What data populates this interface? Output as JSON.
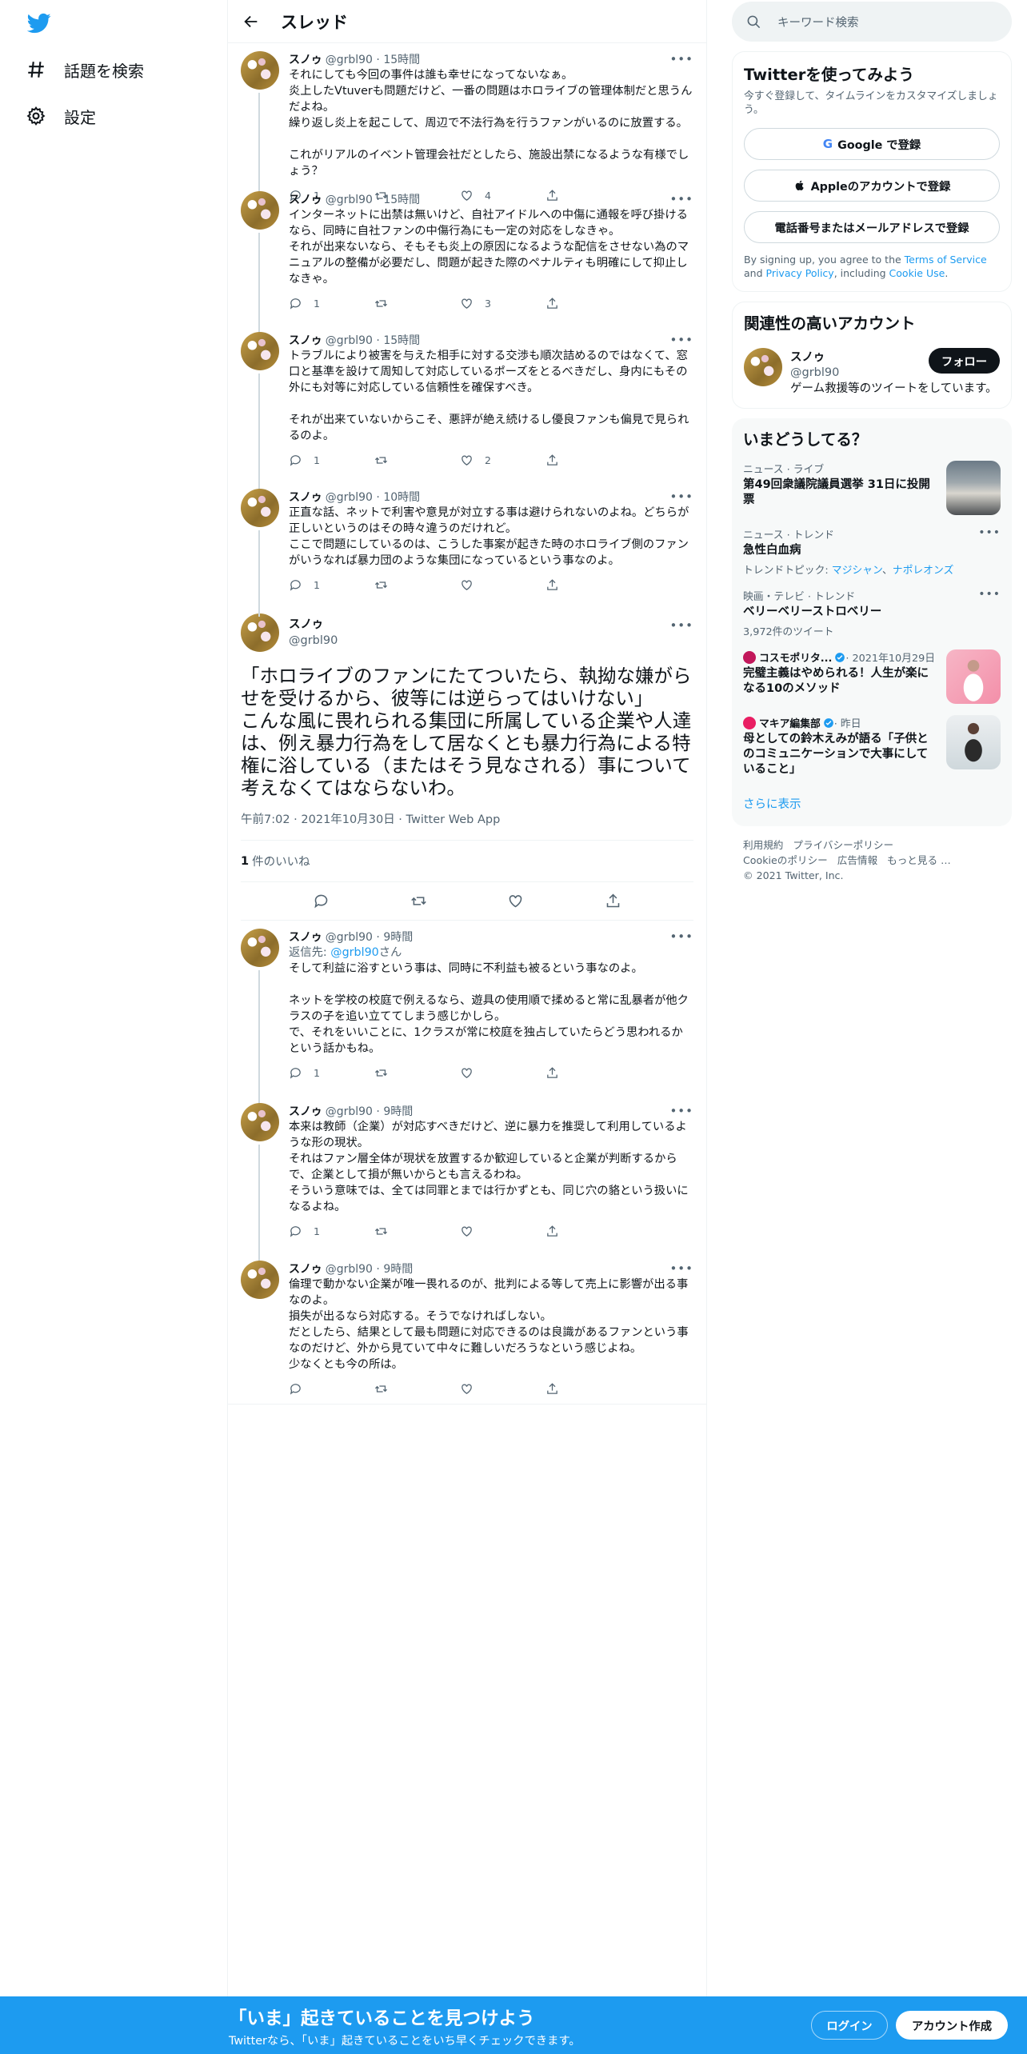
{
  "nav": {
    "explore_label": "話題を検索",
    "settings_label": "設定"
  },
  "header": {
    "title": "スレッド"
  },
  "parent_tweets": [
    {
      "name": "スノゥ",
      "meta": "@grbl90 · 15時間",
      "text": "それにしても今回の事件は誰も幸せになってないなぁ。\n炎上したVtuverも問題だけど、一番の問題はホロライブの管理体制だと思うんだよね。\n繰り返し炎上を起こして、周辺で不法行為を行うファンがいるのに放置する。\n\nこれがリアルのイベント管理会社だとしたら、施設出禁になるような有様でしょう？",
      "reply": "1",
      "retweet": "",
      "like": "4"
    },
    {
      "name": "スノゥ",
      "meta": "@grbl90 · 15時間",
      "text": "インターネットに出禁は無いけど、自社アイドルへの中傷に通報を呼び掛けるなら、同時に自社ファンの中傷行為にも一定の対応をしなきゃ。\nそれが出来ないなら、そもそも炎上の原因になるような配信をさせない為のマニュアルの整備が必要だし、問題が起きた際のペナルティも明確にして抑止しなきゃ。",
      "reply": "1",
      "retweet": "",
      "like": "3"
    },
    {
      "name": "スノゥ",
      "meta": "@grbl90 · 15時間",
      "text": "トラブルにより被害を与えた相手に対する交渉も順次詰めるのではなくて、窓口と基準を設けて周知して対応しているポーズをとるべきだし、身内にもその外にも対等に対応している信頼性を確保すべき。\n\nそれが出来ていないからこそ、悪評が絶え続けるし優良ファンも偏見で見られるのよ。",
      "reply": "1",
      "retweet": "",
      "like": "2"
    },
    {
      "name": "スノゥ",
      "meta": "@grbl90 · 10時間",
      "text": "正直な話、ネットで利害や意見が対立する事は避けられないのよね。どちらが正しいというのはその時々違うのだけれど。\nここで問題にしているのは、こうした事案が起きた時のホロライブ側のファンがいうなれば暴力団のような集団になっているという事なのよ。",
      "reply": "1",
      "retweet": "",
      "like": ""
    }
  ],
  "main_tweet": {
    "name": "スノゥ",
    "handle": "@grbl90",
    "text": "「ホロライブのファンにたてついたら、執拗な嫌がらせを受けるから、彼等には逆らってはいけない」\nこんな風に畏れられる集団に所属している企業や人達は、例え暴力行為をして居なくとも暴力行為による特権に浴している（またはそう見なされる）事について考えなくてはならないわ。",
    "date": "午前7:02 · 2021年10月30日 · Twitter Web App",
    "likes_count": "1",
    "likes_label": "件のいいね"
  },
  "replies": [
    {
      "name": "スノゥ",
      "meta": "@grbl90 · 9時間",
      "reply_to_prefix": "返信先: ",
      "reply_to_handle": "@grbl90",
      "reply_to_suffix": "さん",
      "text": "そして利益に浴すという事は、同時に不利益も被るという事なのよ。\n\nネットを学校の校庭で例えるなら、遊具の使用順で揉めると常に乱暴者が他クラスの子を追い立ててしまう感じかしら。\nで、それをいいことに、1クラスが常に校庭を独占していたらどう思われるかという話かもね。",
      "reply": "1",
      "retweet": "",
      "like": ""
    },
    {
      "name": "スノゥ",
      "meta": "@grbl90 · 9時間",
      "text": "本来は教師（企業）が対応すべきだけど、逆に暴力を推奨して利用しているような形の現状。\nそれはファン層全体が現状を放置するか歓迎していると企業が判断するからで、企業として損が無いからとも言えるわね。\nそういう意味では、全ては同罪とまでは行かずとも、同じ穴の貉という扱いになるよね。",
      "reply": "1",
      "retweet": "",
      "like": ""
    },
    {
      "name": "スノゥ",
      "meta": "@grbl90 · 9時間",
      "text": "倫理で動かない企業が唯一畏れるのが、批判による等して売上に影響が出る事なのよ。\n損失が出るなら対応する。そうでなければしない。\nだとしたら、結果として最も問題に対応できるのは良識があるファンという事なのだけど、外から見ていて中々に難しいだろうなという感じよね。\n少なくとも今の所は。",
      "reply": "",
      "retweet": "",
      "like": ""
    }
  ],
  "right": {
    "search_placeholder": "キーワード検索",
    "signup": {
      "title": "Twitterを使ってみよう",
      "subtitle": "今すぐ登録して、タイムラインをカスタマイズしましょう。",
      "google": "Google で登録",
      "apple": "Appleのアカウントで登録",
      "phone": "電話番号またはメールアドレスで登録",
      "terms_pre": "By signing up, you agree to the ",
      "terms_link": "Terms of Service",
      "terms_mid": " and ",
      "privacy_link": "Privacy Policy",
      "terms_mid2": ", including ",
      "cookie_link": "Cookie Use",
      "terms_end": "."
    },
    "relevant": {
      "title": "関連性の高いアカウント",
      "name": "スノゥ",
      "handle": "@grbl90",
      "follow": "フォロー",
      "bio": "ゲーム救援等のツイートをしています。"
    },
    "trends": {
      "title": "いまどうしてる？",
      "items": [
        {
          "cat": "ニュース · ライブ",
          "name": "第49回衆議院議員選挙 31日に投開票"
        },
        {
          "cat": "ニュース · トレンド",
          "name": "急性白血病",
          "sub_pre": "トレンドトピック: ",
          "sub_link1": "マジシャン",
          "sub_sep": "、",
          "sub_link2": "ナポレオンズ"
        },
        {
          "cat": "映画・テレビ · トレンド",
          "name": "ベリーベリーストロベリー",
          "sub": "3,972件のツイート"
        },
        {
          "src": "コスモポリタ...",
          "time": " · 2021年10月29日",
          "name": "完璧主義はやめられる！人生が楽になる10のメソッド"
        },
        {
          "src": "マキア編集部",
          "time": " · 昨日",
          "name": "母としての鈴木えみが語る「子供とのコミュニケーションで大事にしていること」"
        }
      ],
      "more": "さらに表示"
    },
    "footer": {
      "l1": "利用規約",
      "l2": "プライバシーポリシー",
      "l3": "Cookieのポリシー",
      "l4": "広告情報",
      "l5": "もっと見る …",
      "copy": "© 2021 Twitter, Inc."
    }
  },
  "bottom_bar": {
    "title": "「いま」起きていることを見つけよう",
    "subtitle": "Twitterなら、「いま」起きていることをいち早くチェックできます。",
    "login": "ログイン",
    "signup": "アカウント作成"
  },
  "colors": {
    "accent": "#1d9bf0",
    "text": "#0f1419",
    "muted": "#536471"
  }
}
